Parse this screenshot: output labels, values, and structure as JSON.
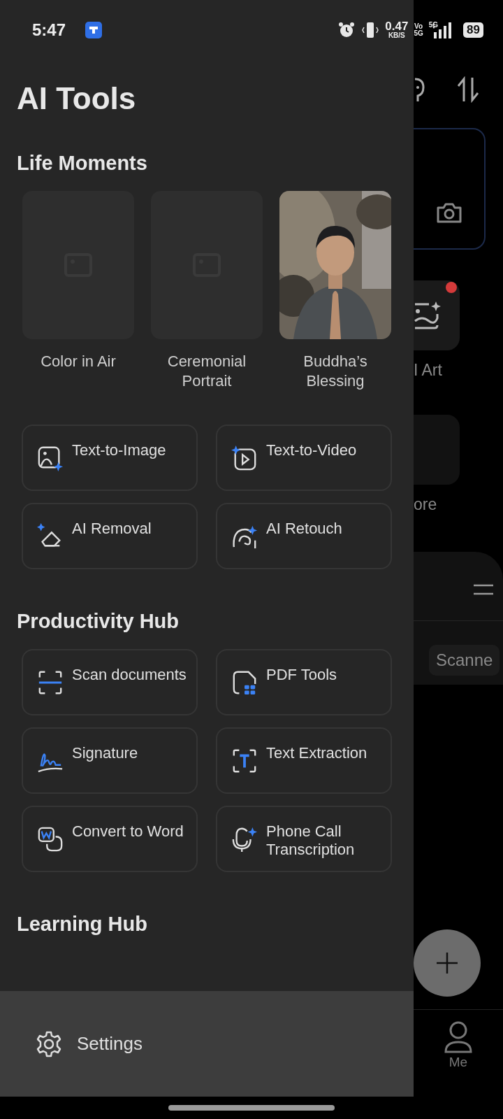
{
  "status_bar": {
    "time": "5:47",
    "net_speed": "0.47",
    "net_unit": "KB/S",
    "volte_top": "Vo",
    "volte_bottom": "5G",
    "signal_label": "5G",
    "battery": "89"
  },
  "drawer": {
    "title": "AI Tools",
    "sections": [
      {
        "heading": "Life Moments",
        "moments": [
          {
            "label": "Color in Air",
            "kind": "placeholder"
          },
          {
            "label": "Ceremonial Portrait",
            "kind": "placeholder"
          },
          {
            "label": "Buddha’s Blessing",
            "kind": "picture"
          }
        ],
        "tools": [
          {
            "label": "Text-to-Image"
          },
          {
            "label": "Text-to-Video"
          },
          {
            "label": "AI Removal"
          },
          {
            "label": "AI Retouch"
          }
        ]
      },
      {
        "heading": "Productivity Hub",
        "tools": [
          {
            "label": "Scan documents"
          },
          {
            "label": "PDF Tools"
          },
          {
            "label": "Signature"
          },
          {
            "label": "Text Extraction"
          },
          {
            "label": "Convert to Word"
          },
          {
            "label": "Phone Call Transcription"
          }
        ]
      },
      {
        "heading": "Learning Hub"
      }
    ],
    "settings": {
      "label": "Settings"
    }
  },
  "background": {
    "tiles": [
      {
        "label": "I Art",
        "badge": true
      },
      {
        "label": "ore",
        "badge": false
      }
    ],
    "chip": "Scanne",
    "nav": {
      "label": "Me"
    }
  }
}
